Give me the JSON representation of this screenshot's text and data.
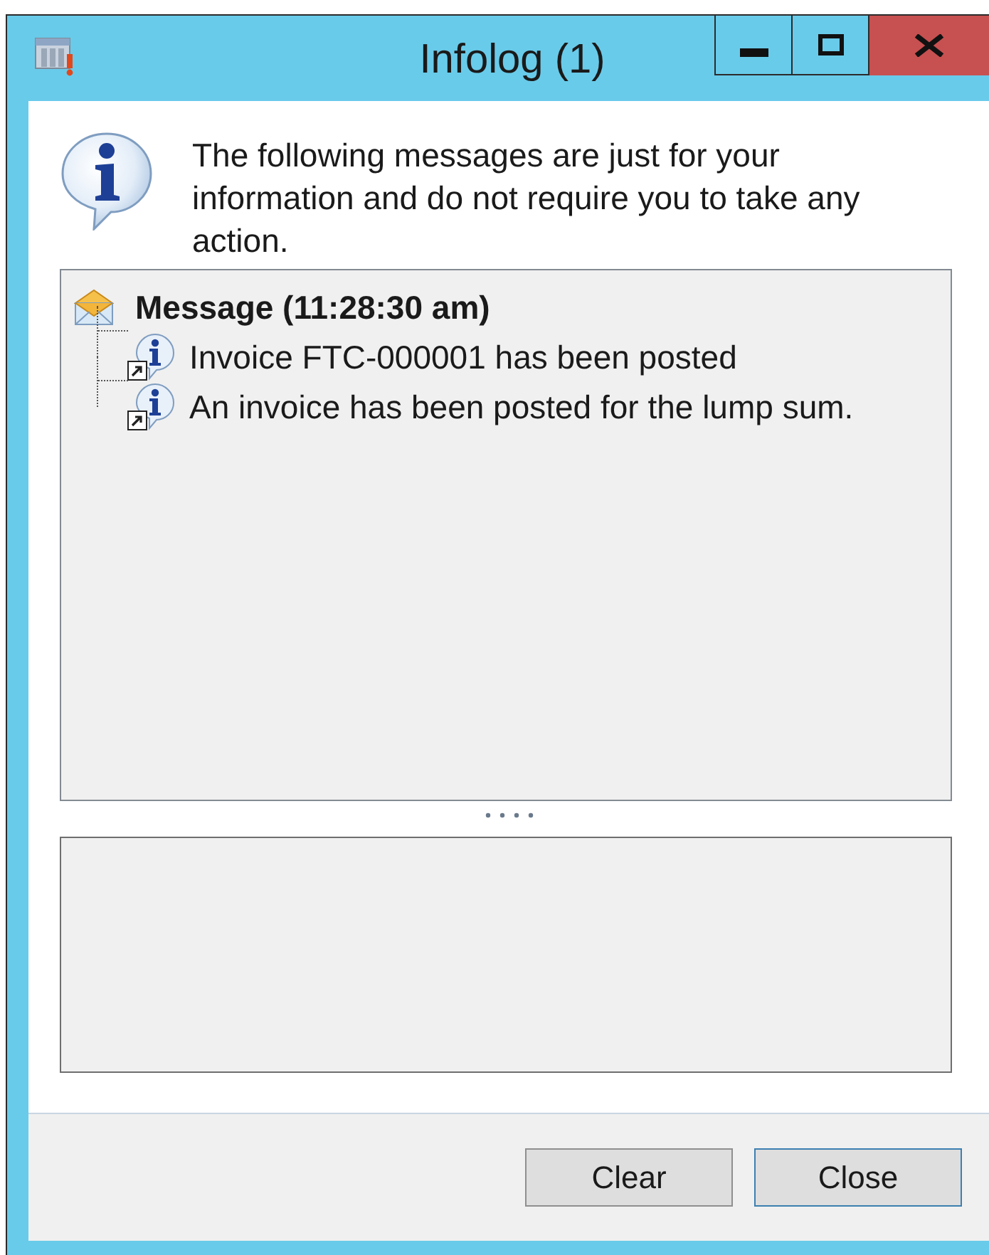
{
  "window": {
    "title": "Infolog (1)"
  },
  "intro": "The following messages are just for your information and do not require you to take any action.",
  "tree": [
    {
      "label": "Message (11:28:30 am)",
      "kind": "message",
      "selected": false,
      "children": [
        {
          "label": "Invoice FTC-000001 has been posted",
          "kind": "info",
          "selected": false
        },
        {
          "label": "An invoice has been posted for the lump sum.",
          "kind": "info",
          "selected": false
        }
      ]
    }
  ],
  "buttons": [
    {
      "label": "Clear",
      "default": false
    },
    {
      "label": "Close",
      "default": true
    }
  ]
}
